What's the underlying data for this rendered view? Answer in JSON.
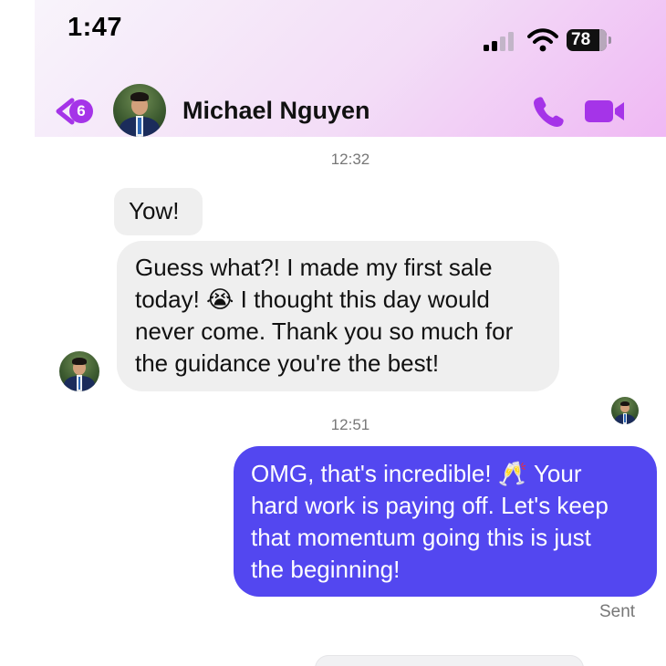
{
  "status_bar": {
    "time": "1:47",
    "battery": "78"
  },
  "header": {
    "back_badge": "6",
    "contact_name": "Michael Nguyen",
    "accent_color": "#a534e8"
  },
  "messages": [
    {
      "type": "timestamp",
      "text": "12:32"
    },
    {
      "type": "incoming",
      "lines": [
        "Yow!"
      ]
    },
    {
      "type": "incoming",
      "lines": [
        "Guess what?! I made my first sale",
        "today! 😭 I thought this day would",
        "never come. Thank you so much for",
        "the guidance you're the best!"
      ]
    },
    {
      "type": "timestamp",
      "text": "12:51"
    },
    {
      "type": "outgoing",
      "lines": [
        "OMG, that's incredible! 🥂 Your",
        "hard work is paying off. Let's keep",
        "that momentum going this is just",
        "the beginning!"
      ]
    }
  ],
  "status": {
    "sent": "Sent"
  },
  "icons": [
    "back-chevron-icon",
    "phone-icon",
    "video-icon",
    "signal-icon",
    "wifi-icon",
    "battery-icon",
    "crying-emoji-icon",
    "clinking-glasses-emoji-icon"
  ]
}
